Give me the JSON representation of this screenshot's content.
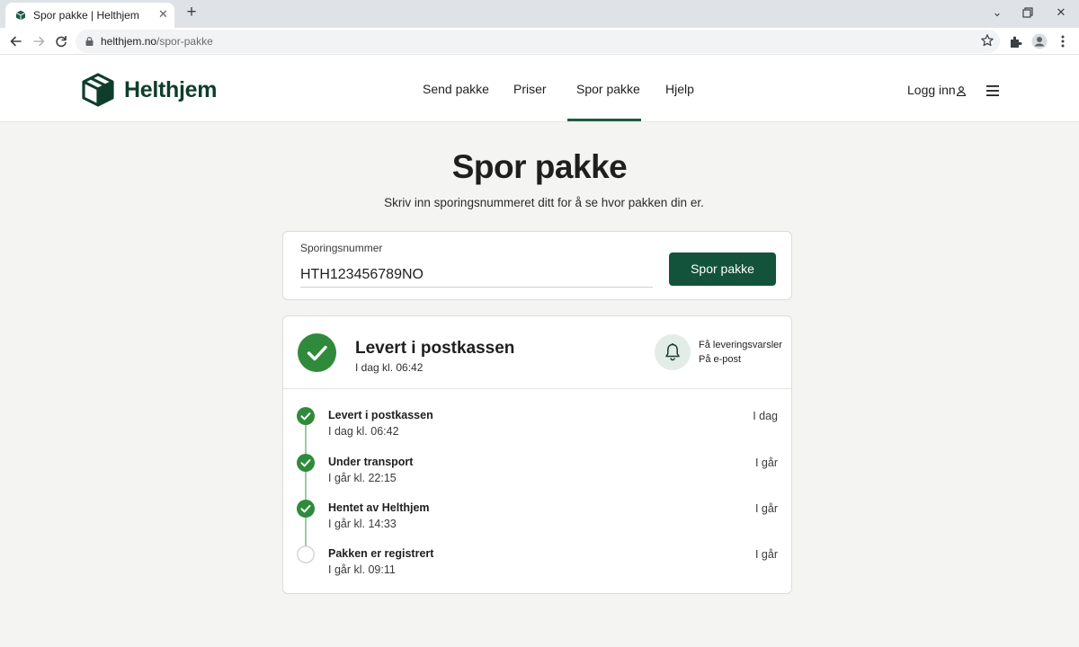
{
  "browser": {
    "tab_title": "Spor pakke | Helthjem",
    "url_host": "helthjem.no",
    "url_path": "/spor-pakke"
  },
  "header": {
    "brand": "Helthjem",
    "nav": [
      {
        "label": "Send pakke"
      },
      {
        "label": "Priser"
      },
      {
        "label": "Spor pakke"
      },
      {
        "label": "Hjelp"
      }
    ],
    "login_label": "Logg inn"
  },
  "hero": {
    "title": "Spor pakke",
    "subtitle": "Skriv inn sporingsnummeret ditt for å se hvor pakken din er."
  },
  "search": {
    "label": "Sporingsnummer",
    "value": "HTH123456789NO",
    "button_label": "Spor pakke"
  },
  "status": {
    "title": "Levert i postkassen",
    "time": "I dag kl. 06:42",
    "notify_line1": "Få leveringsvarsler",
    "notify_line2": "På e-post"
  },
  "timeline": [
    {
      "title": "Levert i postkassen",
      "time": "I dag kl. 06:42",
      "day": "I dag",
      "done": true
    },
    {
      "title": "Under transport",
      "time": "I går kl. 22:15",
      "day": "I går",
      "done": true
    },
    {
      "title": "Hentet av Helthjem",
      "time": "I går kl. 14:33",
      "day": "I går",
      "done": true
    },
    {
      "title": "Pakken er registrert",
      "time": "I går kl. 09:11",
      "day": "I går",
      "done": false
    }
  ],
  "colors": {
    "brand": "#0f3d2c",
    "button": "#14533b",
    "success": "#2f8a3c",
    "success_line": "#9bcba5"
  },
  "icons": [
    "back-icon",
    "forward-icon",
    "reload-icon",
    "lock-icon",
    "star-icon",
    "extensions-icon",
    "profile-icon",
    "more-icon",
    "box-logo-icon",
    "user-icon",
    "menu-icon",
    "check-icon",
    "bell-icon"
  ]
}
